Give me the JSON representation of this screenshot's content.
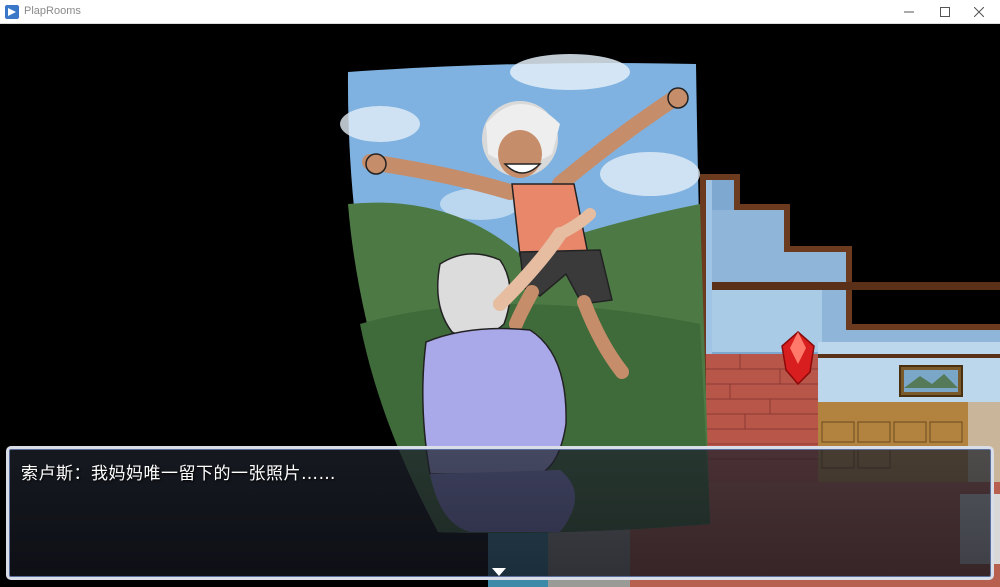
{
  "window": {
    "title": "PlapRooms",
    "controls": {
      "minimize": "minimize-icon",
      "maximize": "maximize-icon",
      "close": "close-icon"
    }
  },
  "dialog": {
    "text": "索卢斯：我妈妈唯一留下的一张照片……",
    "continue_indicator": "triangle-down-icon"
  },
  "colors": {
    "dialog_border": "#d8dde8",
    "sky": "#7fb2e0",
    "hill": "#3f6a3a",
    "wall_blue": "#8fb6d8",
    "wood": "#6b3a1f"
  }
}
